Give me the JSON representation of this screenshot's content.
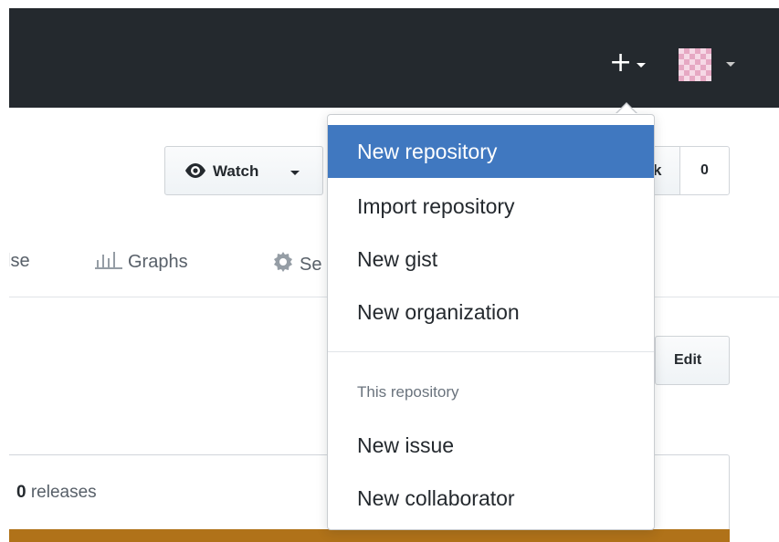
{
  "header": {
    "plus_label": "+",
    "plus_icon": "plus-icon",
    "avatar_icon": "avatar-identicon"
  },
  "repo_actions": {
    "watch_label": "Watch",
    "fork_partial_label": "k",
    "fork_count": "0"
  },
  "tabs": {
    "pulse_partial": "lse",
    "graphs_label": "Graphs",
    "settings_partial": "Se"
  },
  "description": {
    "edit_label": "Edit"
  },
  "stats": {
    "releases_count": "0",
    "releases_label": "releases"
  },
  "dropdown": {
    "items_top": [
      {
        "label": "New repository",
        "active": true
      },
      {
        "label": "Import repository"
      },
      {
        "label": "New gist"
      },
      {
        "label": "New organization"
      }
    ],
    "section_header": "This repository",
    "items_bottom": [
      {
        "label": "New issue"
      },
      {
        "label": "New collaborator"
      }
    ]
  },
  "colors": {
    "header_bg": "#24292e",
    "active_item": "#4078c0",
    "language_bar": "#b07219"
  }
}
